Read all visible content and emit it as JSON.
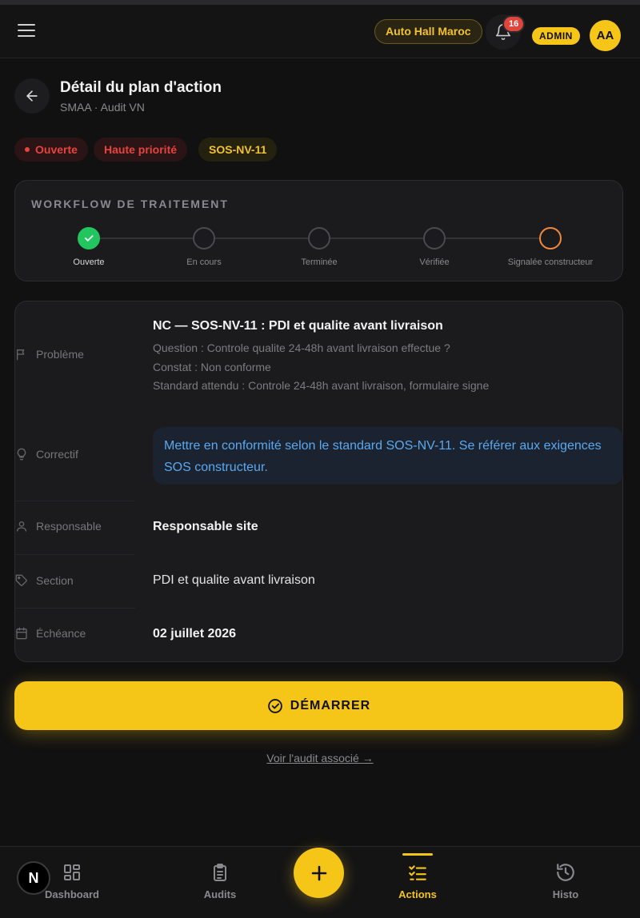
{
  "header": {
    "site_name": "Auto Hall Maroc",
    "notification_count": "16",
    "role": "ADMIN",
    "avatar_initials": "AA"
  },
  "page": {
    "title": "Détail du plan d'action",
    "subtitle": "SMAA · Audit VN"
  },
  "chips": {
    "status": "Ouverte",
    "priority": "Haute priorité",
    "code": "SOS-NV-11"
  },
  "workflow": {
    "title": "WORKFLOW DE TRAITEMENT",
    "steps": [
      {
        "label": "Ouverte",
        "state": "done"
      },
      {
        "label": "En cours",
        "state": "pending"
      },
      {
        "label": "Terminée",
        "state": "pending"
      },
      {
        "label": "Vérifiée",
        "state": "pending"
      },
      {
        "label": "Signalée constructeur",
        "state": "warning"
      }
    ]
  },
  "details": {
    "problem_label": "Problème",
    "problem_title": "NC — SOS-NV-11 : PDI et qualite avant livraison",
    "problem_question": "Question : Controle qualite 24-48h avant livraison effectue ?",
    "problem_finding": "Constat : Non conforme",
    "problem_standard": "Standard attendu : Controle 24-48h avant livraison, formulaire signe",
    "corrective_label": "Correctif",
    "corrective_text": "Mettre en conformité selon le standard SOS-NV-11. Se référer aux exigences SOS constructeur.",
    "responsible_label": "Responsable",
    "responsible_value": "Responsable site",
    "section_label": "Section",
    "section_value": "PDI et qualite avant livraison",
    "deadline_label": "Échéance",
    "deadline_value": "02 juillet 2026"
  },
  "actions": {
    "start_label": "DÉMARRER",
    "audit_link": "Voir l'audit associé →"
  },
  "bottom_nav": {
    "items": [
      {
        "label": "Dashboard",
        "icon": "grid-icon"
      },
      {
        "label": "Audits",
        "icon": "clipboard-icon"
      },
      {
        "label": "Actions",
        "icon": "checklist-icon",
        "active": true
      },
      {
        "label": "Histo",
        "icon": "history-icon"
      }
    ],
    "fab_icon": "plus-icon",
    "n_badge": "N"
  },
  "colors": {
    "accent": "#f5c518",
    "danger": "#e8433d",
    "success": "#22c55e",
    "warning": "#f08a3c",
    "info": "#5aa9f0"
  }
}
